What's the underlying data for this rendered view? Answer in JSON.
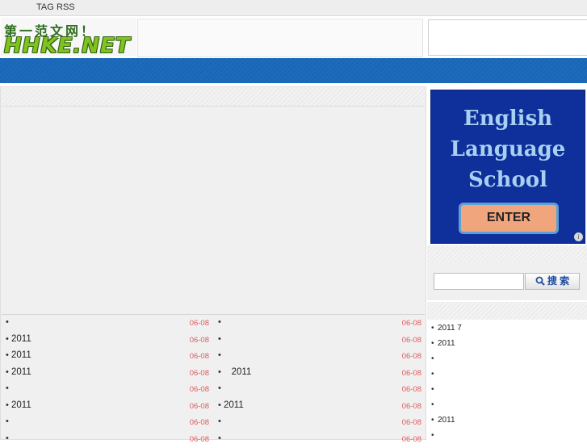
{
  "topbar": {
    "tag": "TAG",
    "rss": "RSS"
  },
  "logo": {
    "cn": "第一范文网！",
    "en": "HHKE.NET"
  },
  "ad": {
    "lines": [
      "English",
      "Language",
      "School"
    ],
    "enter": "ENTER",
    "info_icon": "i"
  },
  "search": {
    "placeholder": "",
    "button_label": "搜 索"
  },
  "list_left": [
    {
      "title": "",
      "date": "06-08"
    },
    {
      "title": "2011",
      "date": "06-08"
    },
    {
      "title": "2011",
      "date": "06-08"
    },
    {
      "title": "2011",
      "date": "06-08"
    },
    {
      "title": "",
      "date": "06-08"
    },
    {
      "title": "2011",
      "date": "06-08"
    },
    {
      "title": "",
      "date": "06-08"
    },
    {
      "title": "",
      "date": "06-08"
    }
  ],
  "list_right": [
    {
      "title": "",
      "date": "06-08"
    },
    {
      "title": "",
      "date": "06-08"
    },
    {
      "title": "",
      "date": "06-08"
    },
    {
      "title": "   2011",
      "date": "06-08"
    },
    {
      "title": "",
      "date": "06-08"
    },
    {
      "title": "2011",
      "date": "06-08"
    },
    {
      "title": "",
      "date": "06-08"
    },
    {
      "title": "",
      "date": "06-08"
    }
  ],
  "side_list": [
    {
      "title": "2011 7"
    },
    {
      "title": "2011"
    },
    {
      "title": ""
    },
    {
      "title": ""
    },
    {
      "title": ""
    },
    {
      "title": ""
    },
    {
      "title": "2011"
    },
    {
      "title": ""
    }
  ],
  "bullet": "•",
  "colors": {
    "nav": "#1b69b8",
    "date": "#e05a5a",
    "ad_bg": "#0f2f9a"
  }
}
